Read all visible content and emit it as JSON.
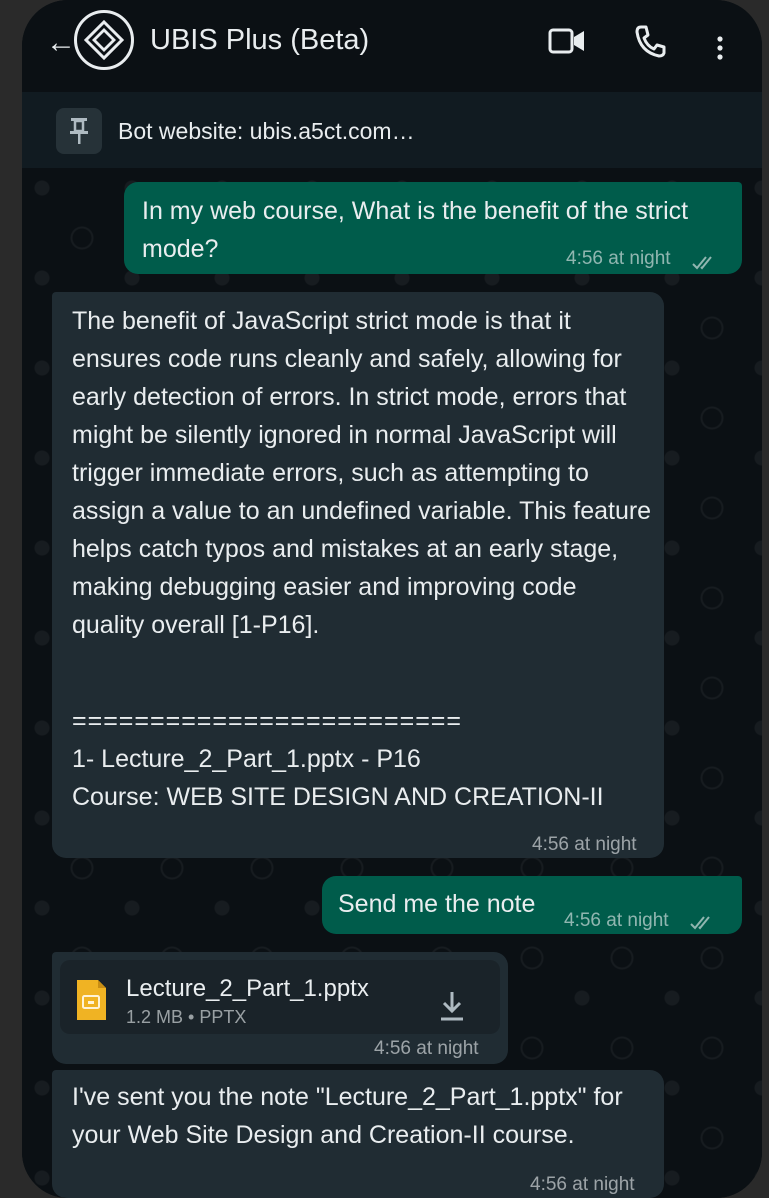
{
  "header": {
    "back_glyph": "←",
    "title": "UBIS Plus (Beta)",
    "icons": [
      "video-call-icon",
      "voice-call-icon",
      "more-options-icon"
    ]
  },
  "pinned": {
    "text": "Bot website: ubis.a5ct.com…"
  },
  "messages": [
    {
      "direction": "outgoing",
      "text": "In my web course, What is the benefit of the strict mode?",
      "time": "4:56 at night",
      "status": "read"
    },
    {
      "direction": "incoming",
      "paragraph": "The benefit of JavaScript strict mode is that it ensures code runs cleanly and safely, allowing for early detection of errors. In strict mode, errors that might be silently ignored in normal JavaScript will trigger immediate errors, such as attempting to assign a value to an undefined variable. This feature helps catch typos and mistakes at an early stage, making debugging easier and improving code quality overall [1-P16].",
      "separator": "=========================",
      "reference": "1- Lecture_2_Part_1.pptx - P16",
      "course": "Course: WEB SITE DESIGN AND CREATION-II",
      "time": "4:56 at night"
    },
    {
      "direction": "outgoing",
      "text": "Send me the note",
      "time": "4:56 at night",
      "status": "read"
    },
    {
      "direction": "incoming",
      "type": "file",
      "file_name": "Lecture_2_Part_1.pptx",
      "file_meta": "1.2 MB • PPTX",
      "time": "4:56 at night"
    },
    {
      "direction": "incoming",
      "text": "I've sent you the note \"Lecture_2_Part_1.pptx\" for your Web Site Design and Creation-II course.",
      "time": "4:56 at night"
    }
  ],
  "colors": {
    "background": "#0b1014",
    "outgoing_bubble": "#005c4b",
    "incoming_bubble": "#202c33",
    "file_icon": "#f0b323"
  }
}
